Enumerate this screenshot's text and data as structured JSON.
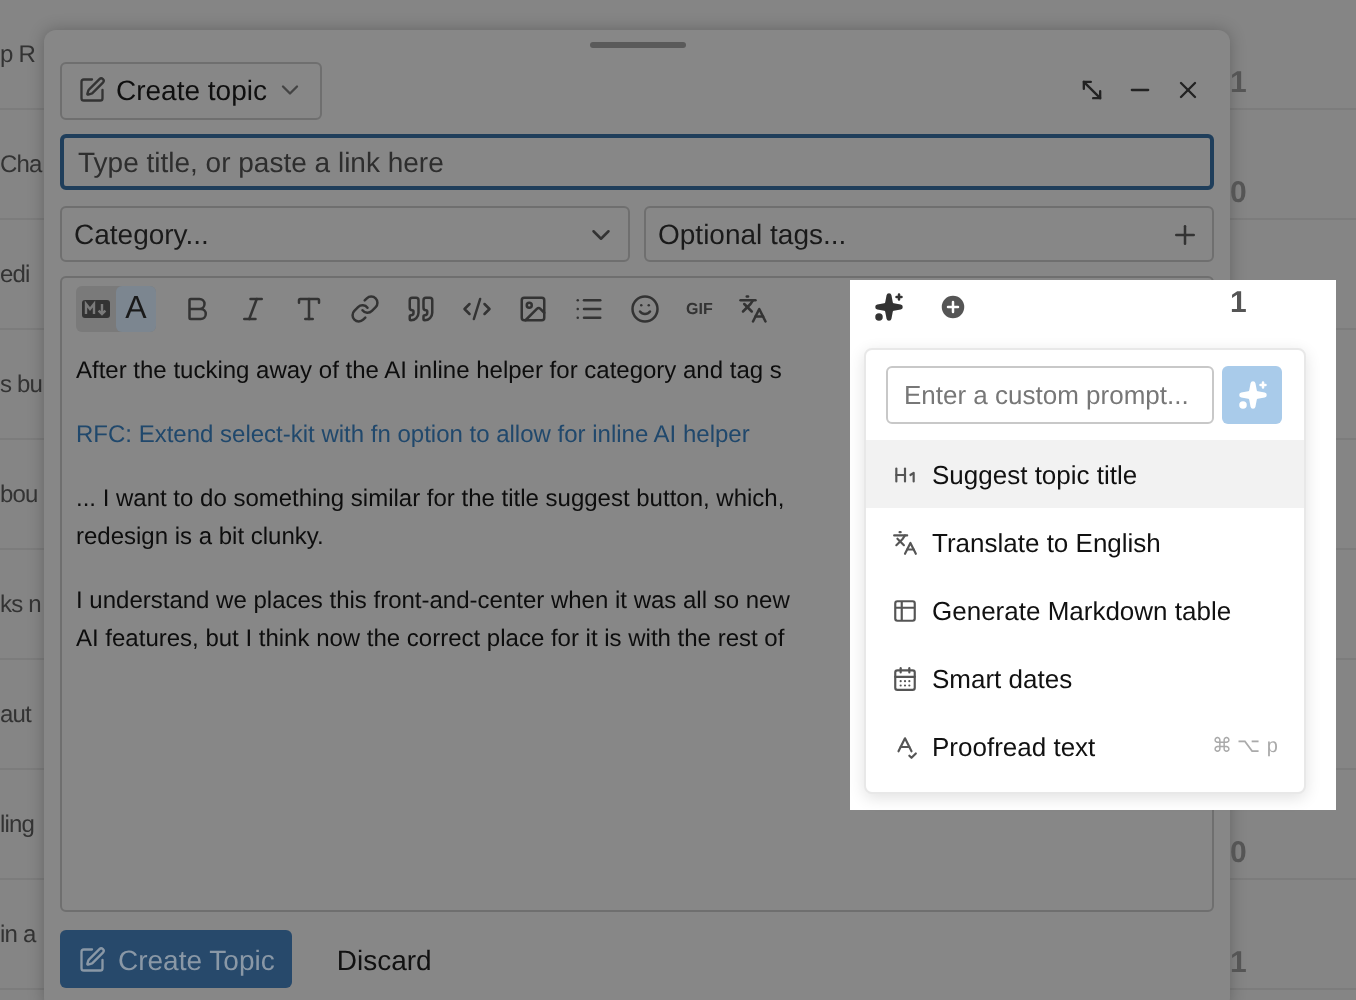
{
  "background_list": {
    "rows": [
      {
        "title": "p R",
        "count": "1"
      },
      {
        "title": "Cha",
        "count": "0"
      },
      {
        "title": "edi",
        "count": "1"
      },
      {
        "title": "s bu"
      },
      {
        "title": "bou"
      },
      {
        "title": "ks n"
      },
      {
        "title": "aut"
      },
      {
        "title": "ling",
        "count": "0"
      },
      {
        "title": "in a",
        "count": "1"
      }
    ]
  },
  "composer": {
    "action": "Create topic",
    "title_field": {
      "placeholder": "Type title, or paste a link here"
    },
    "category": {
      "placeholder": "Category..."
    },
    "tags": {
      "placeholder": "Optional tags..."
    },
    "toolbar": {
      "mode_toggle": [
        {
          "kind": "markdown",
          "selected": false
        },
        {
          "kind": "rich",
          "label": "A",
          "selected": true
        }
      ],
      "buttons": [
        {
          "kind": "bold"
        },
        {
          "kind": "italic"
        },
        {
          "kind": "heading"
        },
        {
          "kind": "link"
        },
        {
          "kind": "quote"
        },
        {
          "kind": "code"
        },
        {
          "kind": "image"
        },
        {
          "kind": "list"
        },
        {
          "kind": "emoji"
        },
        {
          "kind": "gif",
          "label": "GIF"
        },
        {
          "kind": "translate"
        }
      ],
      "ai_buttons": [
        {
          "kind": "ai"
        },
        {
          "kind": "add"
        }
      ]
    },
    "body": [
      {
        "kind": "text",
        "lines": [
          "After the tucking away of the AI inline helper for category and tag s"
        ]
      },
      {
        "kind": "link",
        "lines": [
          "RFC: Extend select-kit with fn option to allow for inline AI helper"
        ]
      },
      {
        "kind": "text",
        "lines": [
          "... I want to do something similar for the title suggest button, which,",
          "redesign is a bit clunky."
        ]
      },
      {
        "kind": "text",
        "lines": [
          "I understand we places this front-and-center when it was all so new",
          "AI features, but I think now the correct place for it is with the rest of"
        ]
      }
    ],
    "submit": "Create Topic",
    "discard": "Discard"
  },
  "ai_menu": {
    "prompt": {
      "placeholder": "Enter a custom prompt..."
    },
    "items": [
      {
        "kind": "heading",
        "label": "Suggest topic title",
        "selected": true
      },
      {
        "kind": "translate",
        "label": "Translate to English",
        "selected": false
      },
      {
        "kind": "table",
        "label": "Generate Markdown table",
        "selected": false
      },
      {
        "kind": "calendar",
        "label": "Smart dates",
        "selected": false
      },
      {
        "kind": "proofread",
        "label": "Proofread text",
        "shortcut": "⌘ ⌥ p",
        "selected": false
      }
    ]
  }
}
